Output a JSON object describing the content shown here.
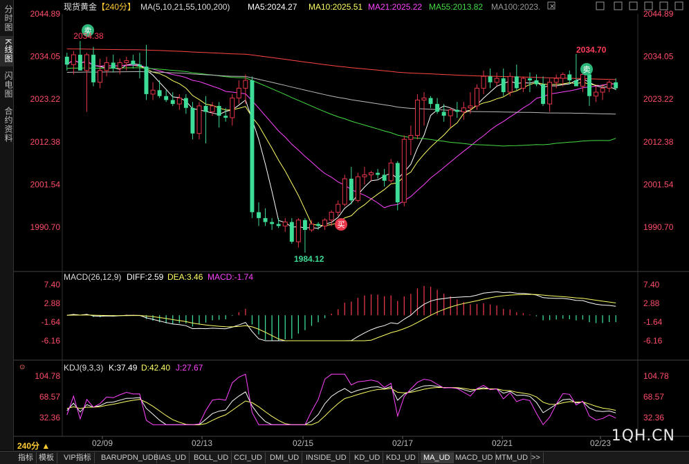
{
  "sidebar": {
    "items": [
      {
        "label": "分时图",
        "active": false
      },
      {
        "label": "K线图",
        "active": true
      },
      {
        "label": "闪电图",
        "active": false
      },
      {
        "label": "合约资料",
        "active": false
      }
    ]
  },
  "header": {
    "symbol": "现货黄金",
    "period_tag": "【240分】",
    "ma_label": "MA(5,10,21,55,100,200)",
    "ma5": "MA5:2024.27",
    "ma10": "MA10:2025.51",
    "ma21": "MA21:2025.22",
    "ma55": "MA55:2013.82",
    "ma100": "MA100:2023."
  },
  "price_axis": {
    "ticks": [
      "2044.89",
      "2034.05",
      "2023.22",
      "2012.38",
      "2001.54",
      "1990.70"
    ],
    "values": [
      2044.89,
      2034.05,
      2023.22,
      2012.38,
      2001.54,
      1990.7
    ]
  },
  "annotations": {
    "sell1_badge": "卖",
    "sell1_price": "2034.38",
    "sell2_badge": "卖",
    "high_price": "2034.70",
    "buy_badge": "买",
    "low_price": "1984.12"
  },
  "macd": {
    "label": "MACD(26,12,9)",
    "diff": "DIFF:2.59",
    "dea": "DEA:3.46",
    "macd": "MACD:-1.74",
    "ticks": [
      "7.40",
      "2.88",
      "-1.64",
      "-6.16"
    ],
    "tick_values": [
      7.4,
      2.88,
      -1.64,
      -6.16
    ]
  },
  "kdj": {
    "label": "KDJ(9,3,3)",
    "k": "K:37.49",
    "d": "D:42.40",
    "j": "J:27.67",
    "ticks": [
      "104.78",
      "68.57",
      "32.36"
    ],
    "tick_values": [
      104.78,
      68.57,
      32.36
    ]
  },
  "x_axis": {
    "labels": [
      "02/09",
      "02/13",
      "02/15",
      "02/17",
      "02/21",
      "02/23"
    ]
  },
  "period_button": "240分 ▲",
  "watermark": "1QH.CN",
  "bottom_tabs": [
    "指标",
    "模板",
    "VIP指标",
    "BARUPDN_UD",
    "BIAS_UD",
    "BOLL_UD",
    "CCI_UD",
    "DMI_UD",
    "INSIDE_UD",
    "KD_UD",
    "KDJ_UD",
    "MA_UD",
    "MACD_UD",
    "MTM_UD",
    ">>"
  ],
  "bottom_active": "MA_UD",
  "colors": {
    "up": "#e8364a",
    "down": "#3ddc97",
    "ma5": "#ffffff",
    "ma10": "#ffff66",
    "ma21": "#ff44ff",
    "ma55": "#44dd44",
    "ma100": "#bbbbbb",
    "ma200": "#ff4444",
    "axis_text": "#ff4d6a"
  },
  "chart_data": {
    "type": "candlestick",
    "candles": [
      [
        2034.0,
        2035.0,
        2030.5,
        2032.0
      ],
      [
        2032.0,
        2035.5,
        2029.5,
        2034.5
      ],
      [
        2034.5,
        2038.0,
        2033.0,
        2030.5
      ],
      [
        2030.5,
        2035.0,
        2020.0,
        2034.5
      ],
      [
        2034.5,
        2036.5,
        2026.5,
        2027.5
      ],
      [
        2027.5,
        2033.5,
        2026.0,
        2030.5
      ],
      [
        2030.5,
        2034.0,
        2029.0,
        2032.5
      ],
      [
        2032.5,
        2034.5,
        2030.0,
        2031.0
      ],
      [
        2031.0,
        2033.5,
        2029.5,
        2032.5
      ],
      [
        2032.5,
        2034.0,
        2030.5,
        2033.0
      ],
      [
        2033.0,
        2034.5,
        2031.0,
        2032.0
      ],
      [
        2032.0,
        2035.0,
        2028.5,
        2031.5
      ],
      [
        2031.5,
        2037.0,
        2023.0,
        2024.5
      ],
      [
        2024.5,
        2027.5,
        2023.0,
        2025.5
      ],
      [
        2025.5,
        2028.0,
        2023.5,
        2024.0
      ],
      [
        2024.0,
        2025.5,
        2022.5,
        2023.0
      ],
      [
        2023.0,
        2025.0,
        2021.5,
        2022.0
      ],
      [
        2022.0,
        2024.5,
        2020.5,
        2023.5
      ],
      [
        2023.5,
        2024.5,
        2019.5,
        2021.0
      ],
      [
        2021.0,
        2022.5,
        2013.0,
        2014.5
      ],
      [
        2014.5,
        2022.5,
        2013.0,
        2021.5
      ],
      [
        2021.5,
        2024.0,
        2012.0,
        2020.0
      ],
      [
        2020.0,
        2022.5,
        2019.0,
        2021.5
      ],
      [
        2021.5,
        2022.5,
        2016.0,
        2019.0
      ],
      [
        2019.0,
        2021.0,
        2017.5,
        2018.5
      ],
      [
        2018.5,
        2024.5,
        2016.5,
        2023.5
      ],
      [
        2023.5,
        2028.0,
        2022.0,
        2026.0
      ],
      [
        2026.0,
        2029.5,
        2022.0,
        2028.0
      ],
      [
        2028.0,
        2029.0,
        1993.0,
        1994.5
      ],
      [
        1994.5,
        1997.0,
        1991.0,
        1993.0
      ],
      [
        1993.0,
        1995.5,
        1991.0,
        1992.0
      ],
      [
        1992.0,
        1993.0,
        1990.0,
        1991.5
      ],
      [
        1991.5,
        1993.0,
        1990.5,
        1991.0
      ],
      [
        1991.0,
        1993.0,
        1989.5,
        1992.0
      ],
      [
        1992.0,
        1993.0,
        1986.5,
        1987.0
      ],
      [
        1987.0,
        1993.0,
        1985.5,
        1992.5
      ],
      [
        1992.5,
        1993.0,
        1984.2,
        1990.0
      ],
      [
        1990.0,
        1992.5,
        1989.5,
        1991.5
      ],
      [
        1991.5,
        1992.0,
        1990.0,
        1991.0
      ],
      [
        1991.0,
        1993.0,
        1990.0,
        1992.5
      ],
      [
        1992.5,
        1995.0,
        1991.0,
        1994.5
      ],
      [
        1994.5,
        1997.5,
        1993.5,
        1996.5
      ],
      [
        1996.5,
        2004.0,
        1996.0,
        2003.0
      ],
      [
        2003.0,
        2006.0,
        1996.5,
        1997.5
      ],
      [
        1997.5,
        2004.5,
        1997.0,
        2003.5
      ],
      [
        2003.5,
        2006.0,
        2001.5,
        2004.0
      ],
      [
        2004.0,
        2005.0,
        2002.5,
        2004.5
      ],
      [
        2004.5,
        2005.5,
        2003.0,
        2004.0
      ],
      [
        2004.0,
        2005.5,
        2001.0,
        2002.5
      ],
      [
        2002.5,
        2008.0,
        2002.0,
        2007.0
      ],
      [
        2007.0,
        2007.5,
        1995.0,
        1997.0
      ],
      [
        1997.0,
        2014.0,
        1996.0,
        2013.0
      ],
      [
        2013.0,
        2016.5,
        2009.0,
        2014.0
      ],
      [
        2014.0,
        2024.5,
        2013.0,
        2023.0
      ],
      [
        2023.0,
        2025.0,
        2016.5,
        2023.5
      ],
      [
        2023.5,
        2024.0,
        2021.0,
        2022.0
      ],
      [
        2022.0,
        2023.5,
        2019.5,
        2020.0
      ],
      [
        2020.0,
        2022.0,
        2017.5,
        2019.0
      ],
      [
        2019.0,
        2021.0,
        2016.0,
        2020.5
      ],
      [
        2020.5,
        2022.5,
        2018.5,
        2020.0
      ],
      [
        2020.0,
        2022.5,
        2018.0,
        2021.0
      ],
      [
        2021.0,
        2025.0,
        2019.5,
        2021.5
      ],
      [
        2021.5,
        2027.0,
        2020.5,
        2026.0
      ],
      [
        2026.0,
        2030.5,
        2024.5,
        2029.0
      ],
      [
        2029.0,
        2031.0,
        2026.0,
        2027.5
      ],
      [
        2027.5,
        2030.0,
        2026.5,
        2028.5
      ],
      [
        2028.5,
        2031.0,
        2024.0,
        2025.0
      ],
      [
        2025.0,
        2030.0,
        2024.0,
        2029.0
      ],
      [
        2029.0,
        2032.0,
        2025.5,
        2026.0
      ],
      [
        2026.0,
        2029.0,
        2025.0,
        2028.5
      ],
      [
        2028.5,
        2030.0,
        2025.0,
        2028.0
      ],
      [
        2028.0,
        2029.5,
        2026.5,
        2027.0
      ],
      [
        2027.0,
        2029.0,
        2021.5,
        2022.0
      ],
      [
        2022.0,
        2028.5,
        2020.0,
        2027.5
      ],
      [
        2027.5,
        2029.5,
        2026.0,
        2028.5
      ],
      [
        2028.5,
        2030.0,
        2026.5,
        2029.5
      ],
      [
        2029.5,
        2030.5,
        2027.0,
        2028.0
      ],
      [
        2028.0,
        2034.7,
        2027.0,
        2026.5
      ],
      [
        2026.5,
        2031.0,
        2025.0,
        2029.5
      ],
      [
        2029.5,
        2031.0,
        2021.5,
        2024.0
      ],
      [
        2024.0,
        2026.5,
        2022.5,
        2025.0
      ],
      [
        2025.0,
        2027.0,
        2023.0,
        2026.0
      ],
      [
        2026.0,
        2028.0,
        2025.0,
        2027.5
      ],
      [
        2027.5,
        2028.5,
        2025.5,
        2026.0
      ]
    ]
  }
}
